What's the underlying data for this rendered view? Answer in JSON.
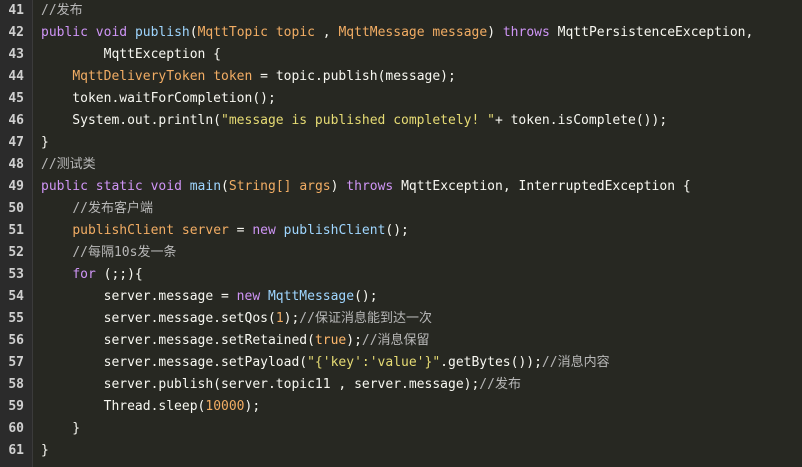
{
  "editor": {
    "lines": [
      {
        "num": "41",
        "tokens": [
          {
            "t": "//发布",
            "c": "comment"
          }
        ]
      },
      {
        "num": "42",
        "tokens": [
          {
            "t": "public",
            "c": "kw"
          },
          {
            "t": " ",
            "c": "plain"
          },
          {
            "t": "void",
            "c": "kw"
          },
          {
            "t": " ",
            "c": "plain"
          },
          {
            "t": "publish",
            "c": "method"
          },
          {
            "t": "(",
            "c": "plain"
          },
          {
            "t": "MqttTopic",
            "c": "type"
          },
          {
            "t": " ",
            "c": "plain"
          },
          {
            "t": "topic",
            "c": "type"
          },
          {
            "t": " , ",
            "c": "plain"
          },
          {
            "t": "MqttMessage",
            "c": "type"
          },
          {
            "t": " ",
            "c": "plain"
          },
          {
            "t": "message",
            "c": "type"
          },
          {
            "t": ") ",
            "c": "plain"
          },
          {
            "t": "throws",
            "c": "kw"
          },
          {
            "t": " MqttPersistenceException,",
            "c": "plain"
          }
        ]
      },
      {
        "num": "43",
        "tokens": [
          {
            "t": "        MqttException {",
            "c": "plain"
          }
        ]
      },
      {
        "num": "44",
        "tokens": [
          {
            "t": "    ",
            "c": "plain"
          },
          {
            "t": "MqttDeliveryToken",
            "c": "type"
          },
          {
            "t": " ",
            "c": "plain"
          },
          {
            "t": "token",
            "c": "type"
          },
          {
            "t": " = topic.publish(message);",
            "c": "plain"
          }
        ]
      },
      {
        "num": "45",
        "tokens": [
          {
            "t": "    token.waitForCompletion();",
            "c": "plain"
          }
        ]
      },
      {
        "num": "46",
        "tokens": [
          {
            "t": "    System.out.println(",
            "c": "plain"
          },
          {
            "t": "\"message is published completely! \"",
            "c": "str"
          },
          {
            "t": "+ token.isComplete());",
            "c": "plain"
          }
        ]
      },
      {
        "num": "47",
        "tokens": [
          {
            "t": "}",
            "c": "plain"
          }
        ]
      },
      {
        "num": "48",
        "tokens": [
          {
            "t": "//测试类",
            "c": "comment"
          }
        ]
      },
      {
        "num": "49",
        "tokens": [
          {
            "t": "public",
            "c": "kw"
          },
          {
            "t": " ",
            "c": "plain"
          },
          {
            "t": "static",
            "c": "kw"
          },
          {
            "t": " ",
            "c": "plain"
          },
          {
            "t": "void",
            "c": "kw"
          },
          {
            "t": " ",
            "c": "plain"
          },
          {
            "t": "main",
            "c": "method"
          },
          {
            "t": "(",
            "c": "plain"
          },
          {
            "t": "String[]",
            "c": "type"
          },
          {
            "t": " ",
            "c": "plain"
          },
          {
            "t": "args",
            "c": "type"
          },
          {
            "t": ") ",
            "c": "plain"
          },
          {
            "t": "throws",
            "c": "kw"
          },
          {
            "t": " MqttException, InterruptedException {",
            "c": "plain"
          }
        ]
      },
      {
        "num": "50",
        "tokens": [
          {
            "t": "    ",
            "c": "plain"
          },
          {
            "t": "//发布客户端",
            "c": "comment"
          }
        ]
      },
      {
        "num": "51",
        "tokens": [
          {
            "t": "    ",
            "c": "plain"
          },
          {
            "t": "publishClient",
            "c": "type"
          },
          {
            "t": " ",
            "c": "plain"
          },
          {
            "t": "server",
            "c": "type"
          },
          {
            "t": " = ",
            "c": "plain"
          },
          {
            "t": "new",
            "c": "kw"
          },
          {
            "t": " ",
            "c": "plain"
          },
          {
            "t": "publishClient",
            "c": "method"
          },
          {
            "t": "();",
            "c": "plain"
          }
        ]
      },
      {
        "num": "52",
        "tokens": [
          {
            "t": "    ",
            "c": "plain"
          },
          {
            "t": "//每隔10s发一条",
            "c": "comment"
          }
        ]
      },
      {
        "num": "53",
        "tokens": [
          {
            "t": "    ",
            "c": "plain"
          },
          {
            "t": "for",
            "c": "kw"
          },
          {
            "t": " (;;){",
            "c": "plain"
          }
        ]
      },
      {
        "num": "54",
        "tokens": [
          {
            "t": "        server.message = ",
            "c": "plain"
          },
          {
            "t": "new",
            "c": "kw"
          },
          {
            "t": " ",
            "c": "plain"
          },
          {
            "t": "MqttMessage",
            "c": "method"
          },
          {
            "t": "();",
            "c": "plain"
          }
        ]
      },
      {
        "num": "55",
        "tokens": [
          {
            "t": "        server.message.setQos(",
            "c": "plain"
          },
          {
            "t": "1",
            "c": "num"
          },
          {
            "t": ");",
            "c": "plain"
          },
          {
            "t": "//保证消息能到达一次",
            "c": "comment"
          }
        ]
      },
      {
        "num": "56",
        "tokens": [
          {
            "t": "        server.message.setRetained(",
            "c": "plain"
          },
          {
            "t": "true",
            "c": "special"
          },
          {
            "t": ");",
            "c": "plain"
          },
          {
            "t": "//消息保留",
            "c": "comment"
          }
        ]
      },
      {
        "num": "57",
        "tokens": [
          {
            "t": "        server.message.setPayload(",
            "c": "plain"
          },
          {
            "t": "\"{'key':'value'}\"",
            "c": "str"
          },
          {
            "t": ".getBytes());",
            "c": "plain"
          },
          {
            "t": "//消息内容",
            "c": "comment"
          }
        ]
      },
      {
        "num": "58",
        "tokens": [
          {
            "t": "        server.publish(server.topic11 , server.message);",
            "c": "plain"
          },
          {
            "t": "//发布",
            "c": "comment"
          }
        ]
      },
      {
        "num": "59",
        "tokens": [
          {
            "t": "        Thread.sleep(",
            "c": "plain"
          },
          {
            "t": "10000",
            "c": "num"
          },
          {
            "t": ");",
            "c": "plain"
          }
        ]
      },
      {
        "num": "60",
        "tokens": [
          {
            "t": "    }",
            "c": "plain"
          }
        ]
      },
      {
        "num": "61",
        "tokens": [
          {
            "t": "}",
            "c": "plain"
          }
        ]
      }
    ]
  }
}
